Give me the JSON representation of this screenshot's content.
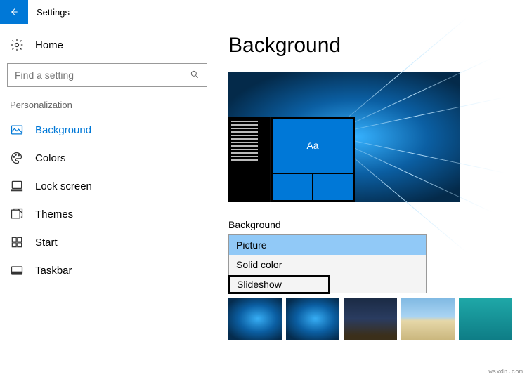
{
  "window": {
    "title": "Settings"
  },
  "sidebar": {
    "home": "Home",
    "search_placeholder": "Find a setting",
    "section": "Personalization",
    "items": [
      {
        "label": "Background",
        "icon": "picture",
        "active": true
      },
      {
        "label": "Colors",
        "icon": "palette",
        "active": false
      },
      {
        "label": "Lock screen",
        "icon": "lock",
        "active": false
      },
      {
        "label": "Themes",
        "icon": "themes",
        "active": false
      },
      {
        "label": "Start",
        "icon": "start",
        "active": false
      },
      {
        "label": "Taskbar",
        "icon": "taskbar",
        "active": false
      }
    ]
  },
  "content": {
    "heading": "Background",
    "preview_tile_text": "Aa",
    "dropdown_label": "Background",
    "options": [
      {
        "label": "Picture",
        "selected": true,
        "highlighted": false
      },
      {
        "label": "Solid color",
        "selected": false,
        "highlighted": false
      },
      {
        "label": "Slideshow",
        "selected": false,
        "highlighted": true
      }
    ],
    "thumbnails": [
      "win10-light-a",
      "win10-light-b",
      "night-hill",
      "beach",
      "underwater"
    ]
  },
  "watermark": "wsxdn.com"
}
